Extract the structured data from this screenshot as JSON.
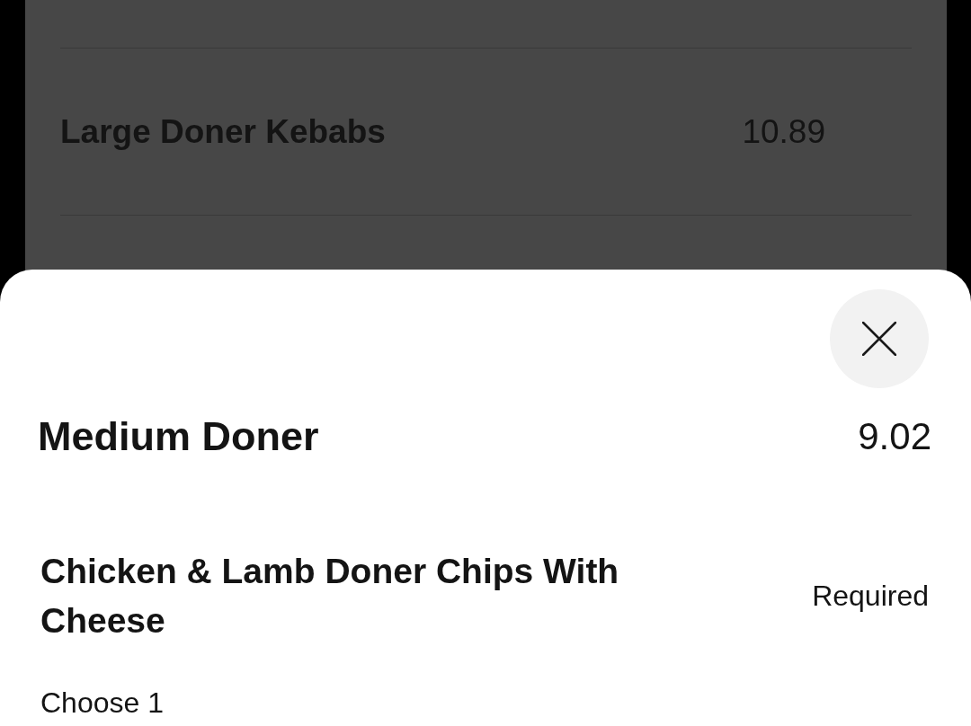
{
  "background_menu": {
    "items": [
      {
        "name": "Large Doner Kebabs",
        "price": "10.89"
      }
    ]
  },
  "item_sheet": {
    "title": "Medium Doner",
    "price": "9.02",
    "option_groups": [
      {
        "title": "Chicken & Lamb Doner Chips With Cheese",
        "badge": "Required",
        "hint": "Choose 1"
      }
    ]
  }
}
